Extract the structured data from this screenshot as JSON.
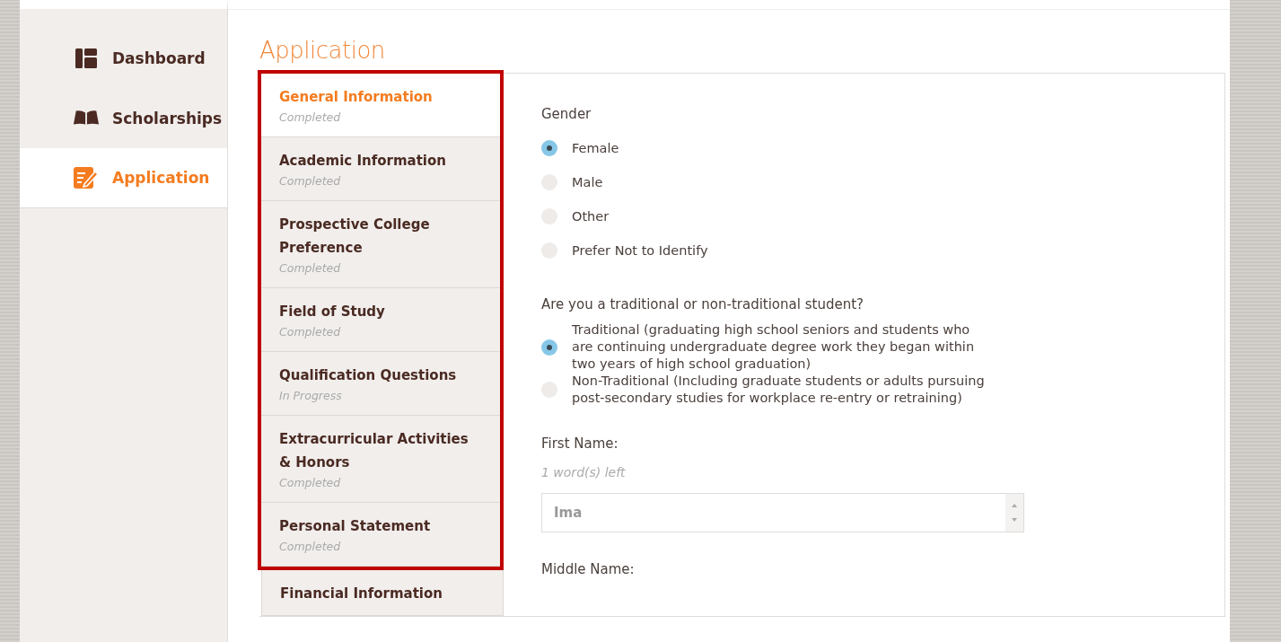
{
  "sidebar": {
    "items": [
      {
        "label": "Dashboard",
        "selected": false
      },
      {
        "label": "Scholarships",
        "selected": false
      },
      {
        "label": "Application",
        "selected": true
      }
    ]
  },
  "page_title": "Application",
  "steps": [
    {
      "title": "General Information",
      "status": "Completed",
      "selected": true,
      "highlighted": true
    },
    {
      "title": "Academic Information",
      "status": "Completed",
      "selected": false,
      "highlighted": true
    },
    {
      "title": "Prospective College Preference",
      "status": "Completed",
      "selected": false,
      "highlighted": true
    },
    {
      "title": "Field of Study",
      "status": "Completed",
      "selected": false,
      "highlighted": true
    },
    {
      "title": "Qualification Questions",
      "status": "In Progress",
      "selected": false,
      "highlighted": true
    },
    {
      "title": "Extracurricular Activities & Honors",
      "status": "Completed",
      "selected": false,
      "highlighted": true
    },
    {
      "title": "Personal Statement",
      "status": "Completed",
      "selected": false,
      "highlighted": true
    },
    {
      "title": "Financial Information",
      "selected": false,
      "highlighted": false
    }
  ],
  "form": {
    "questions": [
      {
        "label": "Gender",
        "options": [
          {
            "label": "Female",
            "selected": true
          },
          {
            "label": "Male",
            "selected": false
          },
          {
            "label": "Other",
            "selected": false
          },
          {
            "label": "Prefer Not to Identify",
            "selected": false
          }
        ]
      },
      {
        "label": "Are you a traditional or non-traditional student?",
        "options": [
          {
            "label": "Traditional (graduating high school seniors and students who are continuing undergraduate degree work they began within two years of high school graduation)",
            "selected": true
          },
          {
            "label": "Non-Traditional (Including graduate students or adults pursuing post-secondary studies for workplace re-entry or retraining)",
            "selected": false
          }
        ]
      }
    ],
    "first_name": {
      "label": "First Name:",
      "hint": "1 word(s) left",
      "value": "Ima"
    },
    "middle_name": {
      "label": "Middle Name:"
    }
  }
}
